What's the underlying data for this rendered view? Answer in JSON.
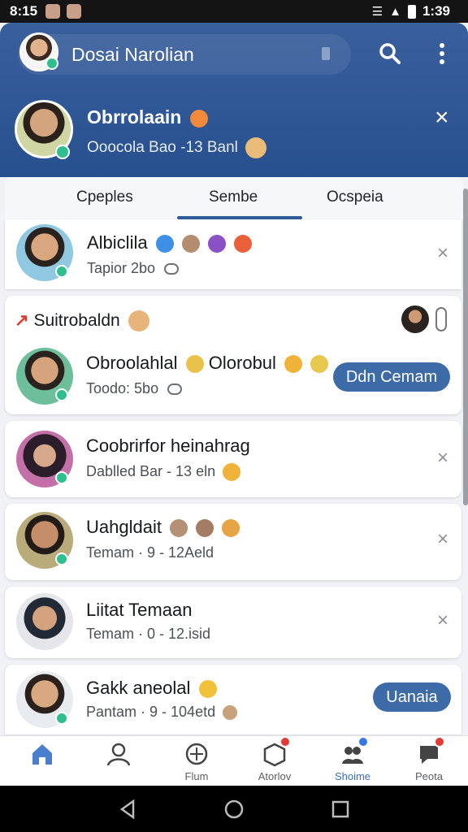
{
  "status_bar": {
    "time": "8:15",
    "clock": "1:39"
  },
  "header": {
    "title": "Dosai Narolian"
  },
  "profile": {
    "name": "Obrrolaain",
    "subtitle": "Ooocola Bao -13 Banl"
  },
  "tabs": [
    {
      "label": "Cpeples"
    },
    {
      "label": "Sembe"
    },
    {
      "label": "Ocspeia"
    }
  ],
  "suggested": {
    "label": "Suitrobaldn"
  },
  "contacts": [
    {
      "name": "Albiclila",
      "status": "Tapior 2bo"
    },
    {
      "name": "Obroolahlal",
      "name2": "Olorobul",
      "status": "Toodo: 5bo",
      "action_label": "Ddn Cemam"
    },
    {
      "name": "Coobrirfor heinahrag",
      "status": "Dablled Bar - 13 eln"
    },
    {
      "name": "Uahgldait",
      "status": "Temam · 9 - 12Aeld"
    },
    {
      "name": "Liitat Temaan",
      "status": "Temam · 0 - 12.isid"
    },
    {
      "name": "Gakk aneolal",
      "status": "Pantam · 9 - 104etd",
      "action_label": "Uanaia"
    }
  ],
  "bottom_nav": [
    {
      "label": ""
    },
    {
      "label": ""
    },
    {
      "label": "Flum"
    },
    {
      "label": "Atorlov"
    },
    {
      "label": "Shoime"
    },
    {
      "label": "Peota"
    }
  ],
  "colors": {
    "header": "#2b5393",
    "accent": "#2f5d9c",
    "button": "#3d6ba8",
    "online": "#2fbf8f"
  }
}
